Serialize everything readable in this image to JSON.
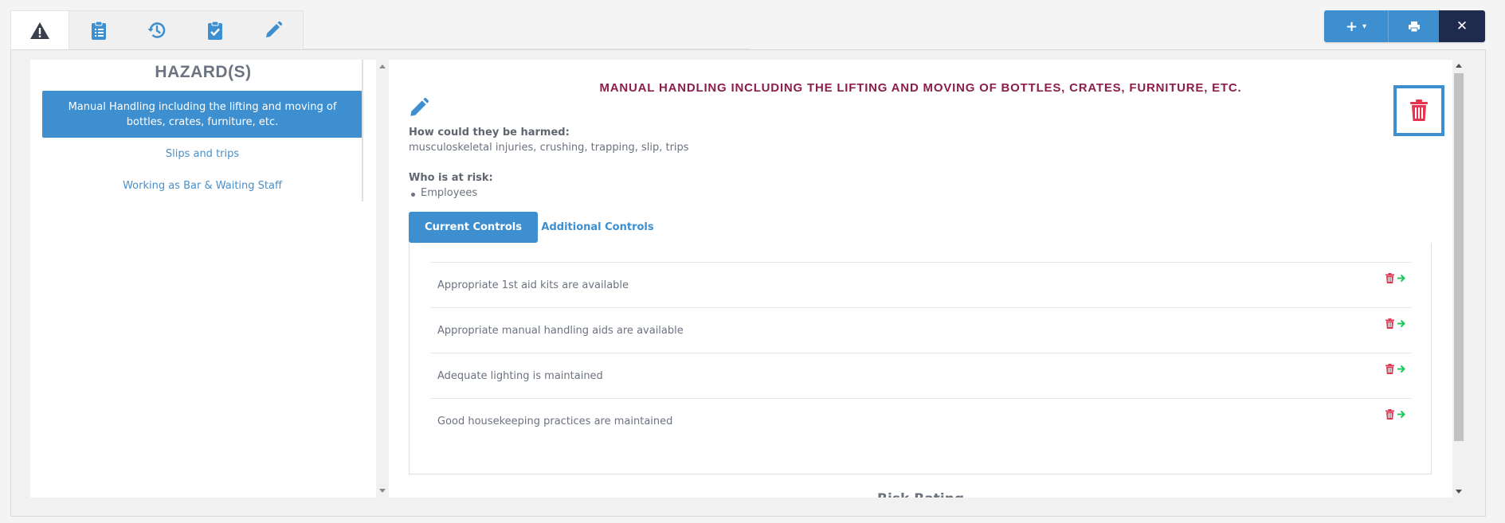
{
  "tabs": [
    {
      "name": "hazards",
      "icon": "warning-icon"
    },
    {
      "name": "checklist",
      "icon": "clipboard-list-icon"
    },
    {
      "name": "history",
      "icon": "history-icon"
    },
    {
      "name": "approval",
      "icon": "clipboard-check-icon"
    },
    {
      "name": "edit",
      "icon": "pencil-icon"
    }
  ],
  "toolbar": {
    "add_label": "+",
    "caret": "▾",
    "print_icon": "print-icon",
    "close_label": "✕"
  },
  "hazards": {
    "title": "HAZARD(S)",
    "items": [
      {
        "label": "Manual Handling including the lifting and moving of bottles, crates, furniture, etc.",
        "active": true
      },
      {
        "label": "Slips and trips",
        "active": false
      },
      {
        "label": "Working as Bar & Waiting Staff",
        "active": false
      }
    ]
  },
  "detail": {
    "title": "MANUAL HANDLING INCLUDING THE LIFTING AND MOVING OF BOTTLES, CRATES, FURNITURE, ETC.",
    "harm_label": "How could they be harmed:",
    "harm_value": "musculoskeletal injuries, crushing, trapping, slip, trips",
    "risk_label": "Who is at risk:",
    "at_risk": [
      "Employees"
    ],
    "tabs": {
      "current": "Current Controls",
      "additional": "Additional Controls"
    },
    "controls": [
      "Appropriate 1st aid kits are available",
      "Appropriate manual handling aids are available",
      "Adequate lighting is maintained",
      "Good housekeeping practices are maintained"
    ],
    "next_heading": "Risk Rating"
  },
  "colors": {
    "accent": "#3d8fcf",
    "title": "#8b1e4a",
    "danger": "#e5344f",
    "success": "#22c55e",
    "dark": "#1f2a4f"
  }
}
